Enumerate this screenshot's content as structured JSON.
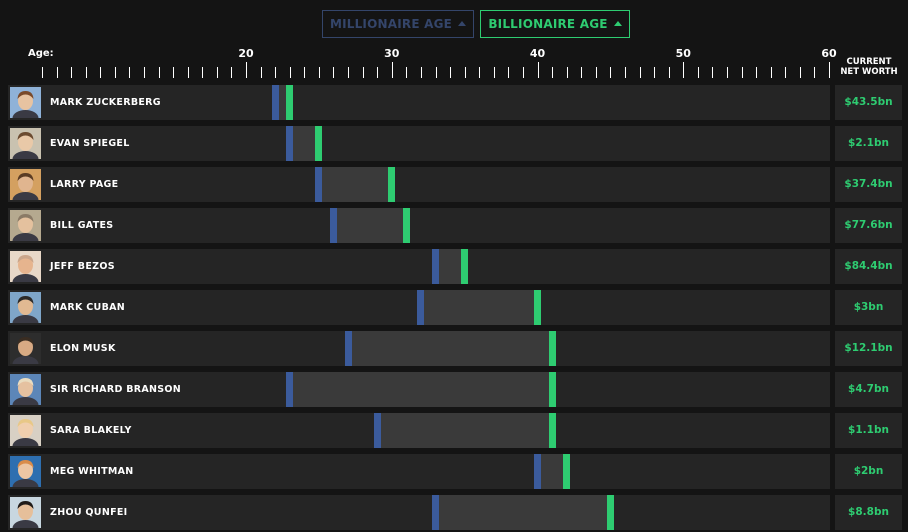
{
  "toggles": {
    "millionaire_label": "MILLIONAIRE AGE",
    "billionaire_label": "BILLIONAIRE AGE"
  },
  "colors": {
    "millionaire": "#3b5b9c",
    "billionaire": "#2ecc71",
    "span": "#3a3a3a",
    "row": "#252525"
  },
  "header": {
    "net_worth_line1": "CURRENT",
    "net_worth_line2": "NET WORTH"
  },
  "chart_data": {
    "type": "bar",
    "xlabel": "Age:",
    "xlim": [
      6,
      60
    ],
    "xticks": [
      20,
      30,
      40,
      50,
      60
    ],
    "series_names": [
      "MILLIONAIRE AGE",
      "BILLIONAIRE AGE"
    ],
    "people": [
      {
        "name": "MARK ZUCKERBERG",
        "millionaire_age": 22,
        "billionaire_age": 23,
        "net_worth": "$43.5bn",
        "avatar_icon": "avatar-zuckerberg"
      },
      {
        "name": "EVAN SPIEGEL",
        "millionaire_age": 23,
        "billionaire_age": 25,
        "net_worth": "$2.1bn",
        "avatar_icon": "avatar-spiegel"
      },
      {
        "name": "LARRY PAGE",
        "millionaire_age": 25,
        "billionaire_age": 30,
        "net_worth": "$37.4bn",
        "avatar_icon": "avatar-page"
      },
      {
        "name": "BILL GATES",
        "millionaire_age": 26,
        "billionaire_age": 31,
        "net_worth": "$77.6bn",
        "avatar_icon": "avatar-gates"
      },
      {
        "name": "JEFF BEZOS",
        "millionaire_age": 33,
        "billionaire_age": 35,
        "net_worth": "$84.4bn",
        "avatar_icon": "avatar-bezos"
      },
      {
        "name": "MARK CUBAN",
        "millionaire_age": 32,
        "billionaire_age": 40,
        "net_worth": "$3bn",
        "avatar_icon": "avatar-cuban"
      },
      {
        "name": "ELON MUSK",
        "millionaire_age": 27,
        "billionaire_age": 41,
        "net_worth": "$12.1bn",
        "avatar_icon": "avatar-musk"
      },
      {
        "name": "SIR RICHARD BRANSON",
        "millionaire_age": 23,
        "billionaire_age": 41,
        "net_worth": "$4.7bn",
        "avatar_icon": "avatar-branson"
      },
      {
        "name": "SARA BLAKELY",
        "millionaire_age": 29,
        "billionaire_age": 41,
        "net_worth": "$1.1bn",
        "avatar_icon": "avatar-blakely"
      },
      {
        "name": "MEG WHITMAN",
        "millionaire_age": 40,
        "billionaire_age": 42,
        "net_worth": "$2bn",
        "avatar_icon": "avatar-whitman"
      },
      {
        "name": "ZHOU QUNFEI",
        "millionaire_age": 33,
        "billionaire_age": 45,
        "net_worth": "$8.8bn",
        "avatar_icon": "avatar-zhou"
      }
    ]
  }
}
